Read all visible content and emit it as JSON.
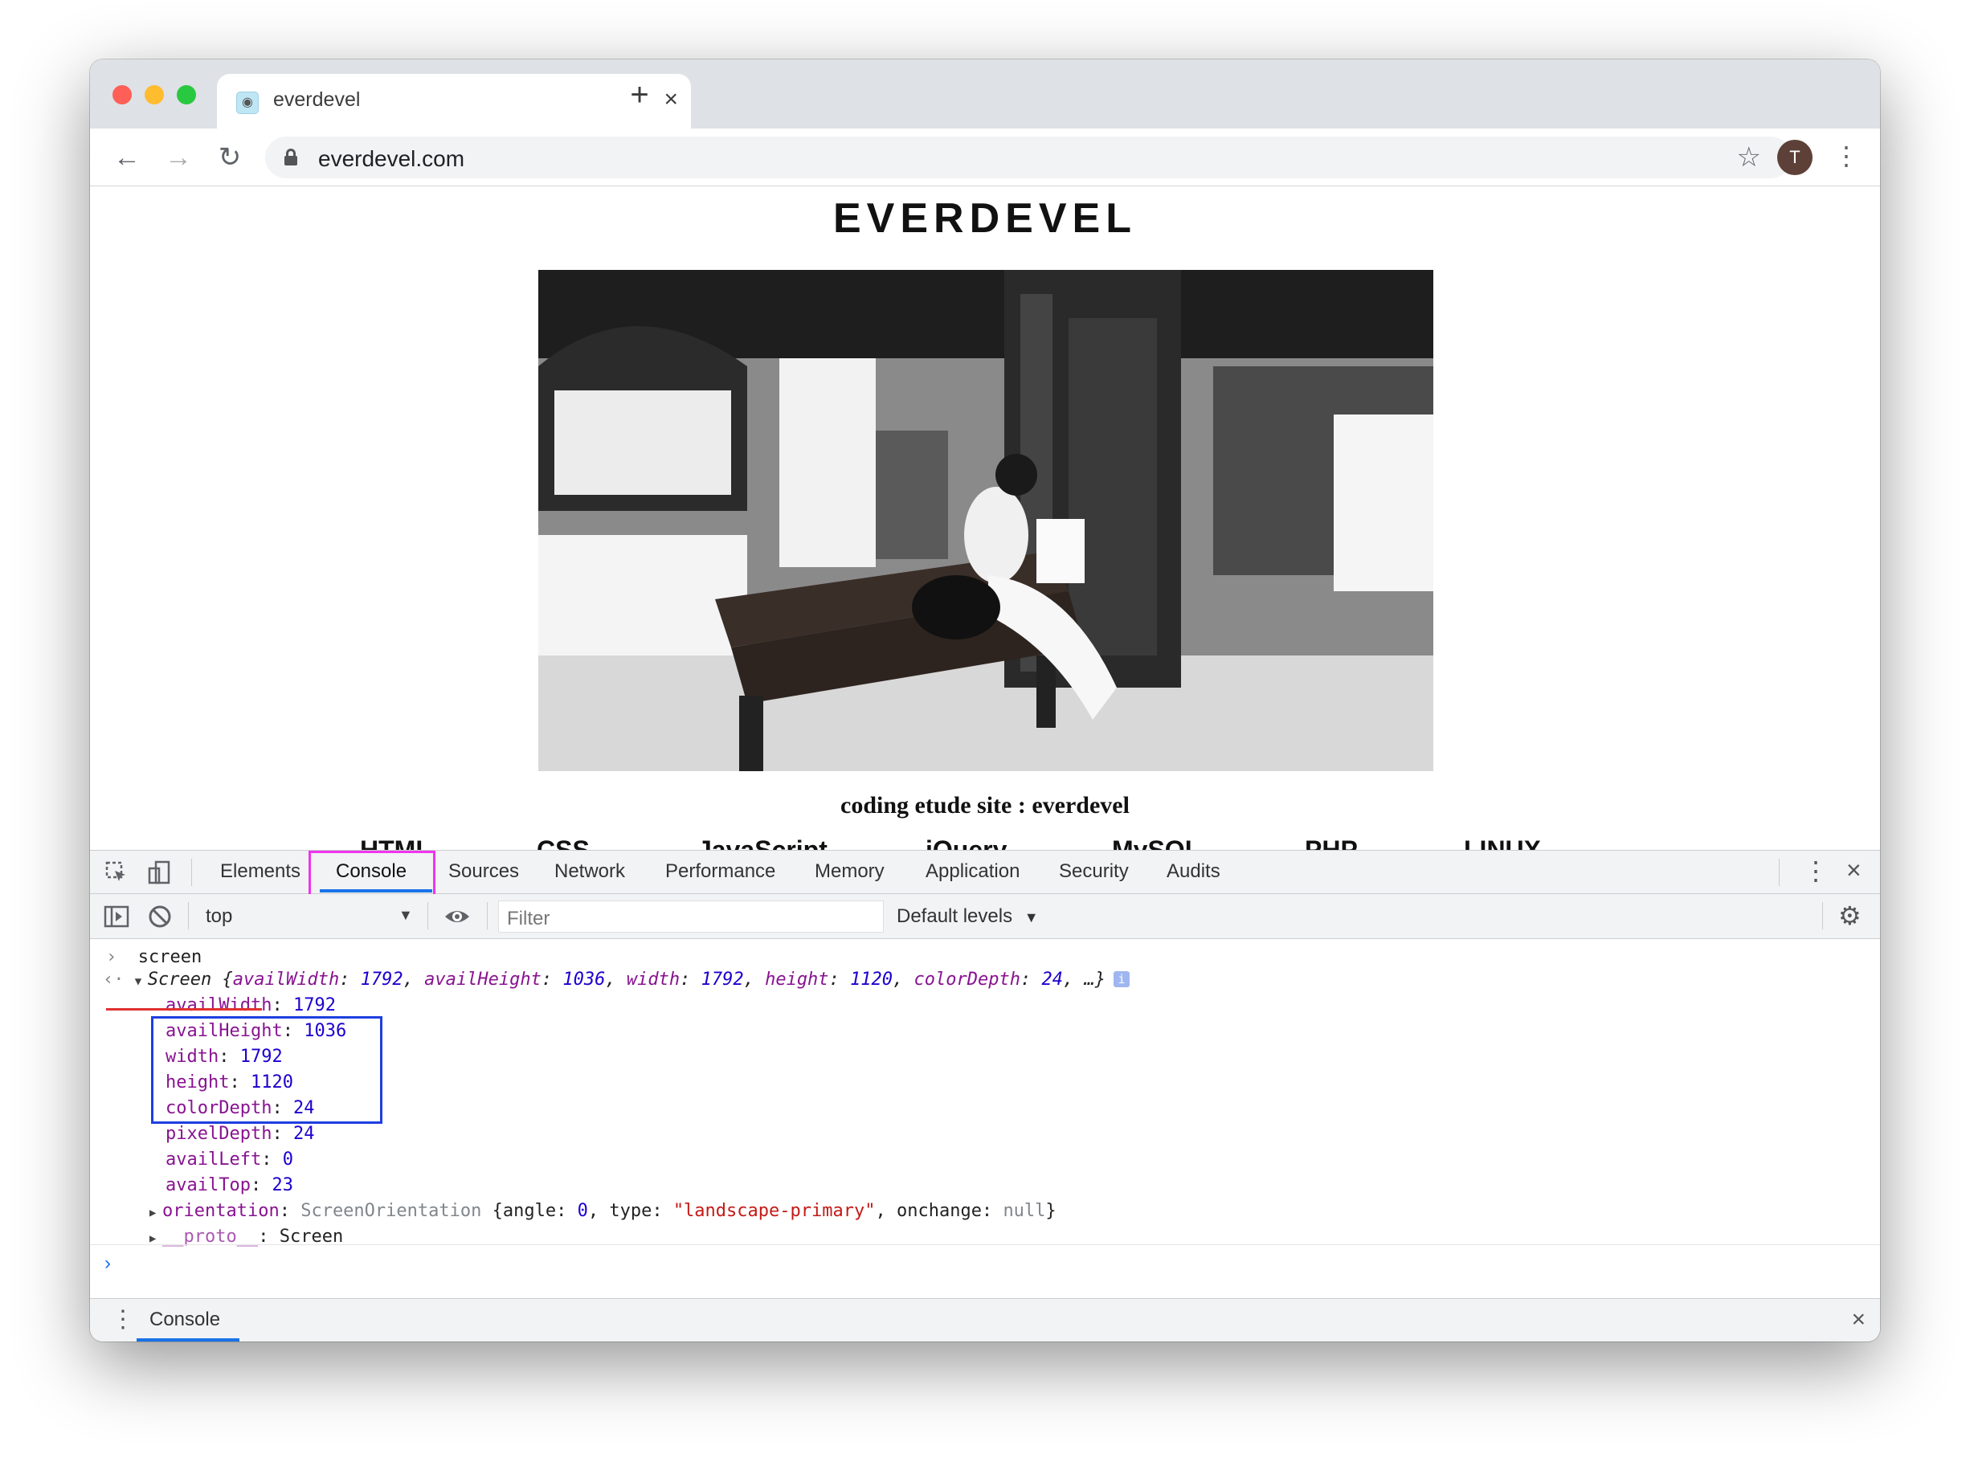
{
  "browser": {
    "tab_title": "everdevel",
    "url": "everdevel.com",
    "profile_initial": "T"
  },
  "page": {
    "site_title": "EVERDEVEL",
    "hero_caption": "coding etude site : everdevel",
    "menu": [
      "HTML",
      "CSS",
      "JavaScript",
      "jQuery",
      "MySQL",
      "PHP",
      "LINUX"
    ]
  },
  "devtools": {
    "tabs": [
      "Elements",
      "Console",
      "Sources",
      "Network",
      "Performance",
      "Memory",
      "Application",
      "Security",
      "Audits"
    ],
    "active_tab": "Console",
    "context": "top",
    "filter_placeholder": "Filter",
    "levels": "Default levels",
    "input_command": "screen",
    "summary": {
      "class": "Screen",
      "availWidth": "1792",
      "availHeight": "1036",
      "width": "1792",
      "height": "1120",
      "colorDepth": "24",
      "ellipsis": "…"
    },
    "properties": [
      {
        "key": "availWidth",
        "value": "1792"
      },
      {
        "key": "availHeight",
        "value": "1036"
      },
      {
        "key": "width",
        "value": "1792"
      },
      {
        "key": "height",
        "value": "1120"
      },
      {
        "key": "colorDepth",
        "value": "24"
      },
      {
        "key": "pixelDepth",
        "value": "24"
      },
      {
        "key": "availLeft",
        "value": "0"
      },
      {
        "key": "availTop",
        "value": "23"
      }
    ],
    "orientation": {
      "key": "orientation",
      "class": "ScreenOrientation",
      "angle": "0",
      "type": "\"landscape-primary\"",
      "onchange": "null"
    },
    "proto": {
      "key": "__proto__",
      "value": "Screen"
    },
    "drawer_tab": "Console"
  },
  "colors": {
    "accent": "#1a73e8",
    "highlight_magenta": "#ee35ee",
    "highlight_blue": "#1f3fe0",
    "highlight_red": "#e03131"
  }
}
